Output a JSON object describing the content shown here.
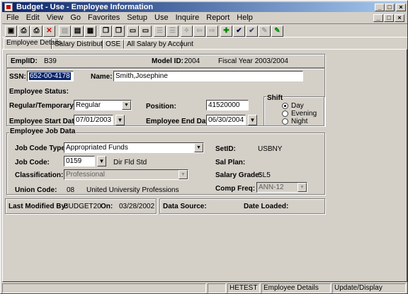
{
  "window": {
    "title": "Budget - Use - Employee Information"
  },
  "menu": [
    "File",
    "Edit",
    "View",
    "Go",
    "Favorites",
    "Setup",
    "Use",
    "Inquire",
    "Report",
    "Help"
  ],
  "tabs": [
    "Employee Details",
    "Salary Distribution",
    "OSE",
    "All Salary by Account"
  ],
  "header": {
    "emplid_label": "EmplID:",
    "emplid_value": "B39",
    "model_label": "Model ID:",
    "model_value": "2004",
    "fiscal_year": "Fiscal Year 2003/2004"
  },
  "employee": {
    "ssn_label": "SSN:",
    "ssn_value": "652-00-4178",
    "name_label": "Name:",
    "name_value": "Smith,Josephine",
    "status_label": "Employee Status:",
    "regtemp_label": "Regular/Temporary:",
    "regtemp_value": "Regular",
    "position_label": "Position:",
    "position_value": "41520000",
    "start_label": "Employee Start Date:",
    "start_value": "07/01/2003",
    "end_label": "Employee End Date:",
    "end_value": "06/30/2004"
  },
  "shift": {
    "label": "Shift",
    "options": [
      "Day",
      "Evening",
      "Night"
    ],
    "selected": "Day"
  },
  "job": {
    "group_label": "Employee Job Data",
    "code_type_label": "Job Code Type:",
    "code_type_value": "Appropriated Funds",
    "code_label": "Job Code:",
    "code_value": "0159",
    "code_desc": "Dir Fld Std",
    "class_label": "Classification:",
    "class_value": "Professional",
    "union_label": "Union Code:",
    "union_code": "08",
    "union_name": "United University Professions",
    "setid_label": "SetID:",
    "setid_value": "USBNY",
    "salplan_label": "Sal Plan:",
    "salplan_value": "",
    "grade_label": "Salary Grade:",
    "grade_value": "SL5",
    "compfreq_label": "Comp Freq:",
    "compfreq_value": "ANN-12"
  },
  "footer": {
    "modified_label": "Last Modified By:",
    "modified_value": "BUDGET20",
    "on_label": "On:",
    "on_value": "03/28/2002",
    "source_label": "Data Source:",
    "loaded_label": "Date Loaded:"
  },
  "status": {
    "pane1": "",
    "db": "HETEST",
    "page": "Employee Details",
    "mode": "Update/Display"
  },
  "toolbar_icons": [
    "save-icon",
    "print-icon",
    "print-all-icon",
    "delete-icon",
    "copy-icon",
    "paste-icon",
    "grid-icon",
    "new-window-icon",
    "new-window-2-icon",
    "doc-icon",
    "doc-2-icon",
    "list-icon",
    "list-2-icon",
    "refresh-icon",
    "back-icon",
    "forward-icon",
    "add-icon",
    "check-icon",
    "check-2-icon",
    "edit-icon",
    "pencil-icon"
  ],
  "colors": {
    "title_start": "#0a246a",
    "title_end": "#a6caf0",
    "face": "#d4d0c8",
    "selection": "#0a246a"
  }
}
